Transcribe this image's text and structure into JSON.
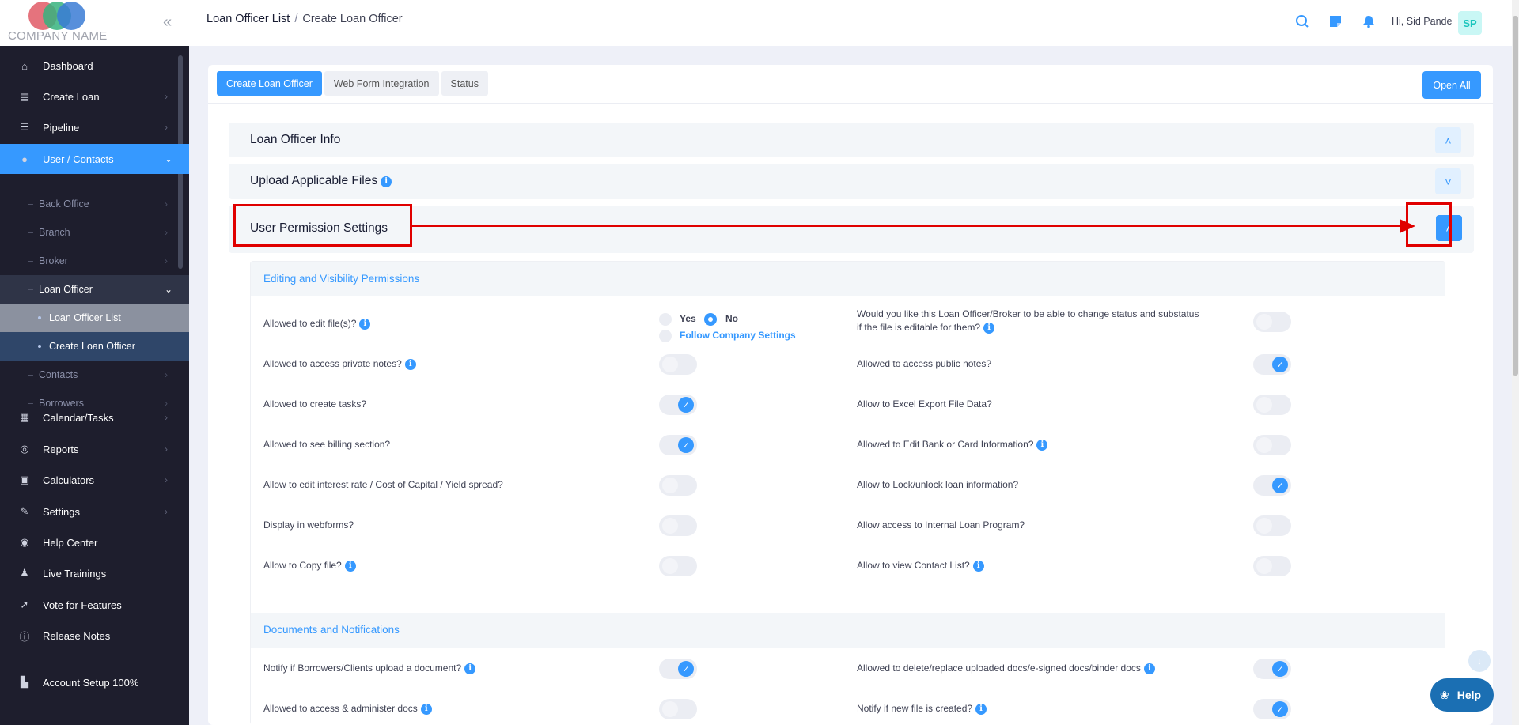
{
  "brand": {
    "company_name": "COMPANY NAME",
    "colors": {
      "red": "#e05b66",
      "green": "#36b37e",
      "blue": "#3a7bd5",
      "accent": "#3699ff"
    }
  },
  "sidebar": {
    "items": [
      {
        "label": "Dashboard",
        "icon": "home-icon"
      },
      {
        "label": "Create Loan",
        "icon": "document-icon"
      },
      {
        "label": "Pipeline",
        "icon": "list-icon"
      },
      {
        "label": "User / Contacts",
        "icon": "user-icon"
      },
      {
        "label": "Calendar/Tasks",
        "icon": "calendar-icon"
      },
      {
        "label": "Reports",
        "icon": "chart-icon"
      },
      {
        "label": "Calculators",
        "icon": "calculator-icon"
      },
      {
        "label": "Settings",
        "icon": "wrench-icon"
      },
      {
        "label": "Help Center",
        "icon": "lifebuoy-icon"
      },
      {
        "label": "Live Trainings",
        "icon": "trainer-icon"
      },
      {
        "label": "Vote for Features",
        "icon": "rocket-icon"
      },
      {
        "label": "Release Notes",
        "icon": "alert-circle-icon"
      },
      {
        "label": "Account Setup 100%",
        "icon": "setup-icon"
      }
    ],
    "user_contacts_children": [
      "Back Office",
      "Branch",
      "Broker",
      "Loan Officer",
      "Contacts",
      "Borrowers"
    ],
    "loan_officer_children": [
      "Loan Officer List",
      "Create Loan Officer"
    ]
  },
  "header": {
    "breadcrumb_parent": "Loan Officer List",
    "breadcrumb_sep": "/",
    "breadcrumb_current": "Create Loan Officer",
    "greeting": "Hi, Sid Pande",
    "avatar_initials": "SP"
  },
  "tabs": [
    "Create Loan Officer",
    "Web Form Integration",
    "Status"
  ],
  "open_all_label": "Open All",
  "sections": {
    "loan_officer_info": "Loan Officer Info",
    "upload_files": "Upload Applicable Files",
    "user_permissions": "User Permission Settings"
  },
  "permissions": {
    "editing_title": "Editing and Visibility Permissions",
    "edit_files_question": "Allowed to edit file(s)?",
    "radio_yes": "Yes",
    "radio_no": "No",
    "radio_follow": "Follow Company Settings",
    "change_status_question_line1": "Would you like this Loan Officer/Broker to be able to change status and substatus",
    "change_status_question_line2": "if the file is editable for them?",
    "rows": [
      {
        "left": "Allowed to access private notes?",
        "left_on": false,
        "left_info": true,
        "right": "Allowed to access public notes?",
        "right_on": true,
        "right_info": false
      },
      {
        "left": "Allowed to create tasks?",
        "left_on": true,
        "left_info": false,
        "right": "Allow to Excel Export File Data?",
        "right_on": false,
        "right_info": false
      },
      {
        "left": "Allowed to see billing section?",
        "left_on": true,
        "left_info": false,
        "right": "Allowed to Edit Bank or Card Information?",
        "right_on": false,
        "right_info": true
      },
      {
        "left": "Allow to edit interest rate / Cost of Capital / Yield spread?",
        "left_on": false,
        "left_info": false,
        "right": "Allow to Lock/unlock loan information?",
        "right_on": true,
        "right_info": false
      },
      {
        "left": "Display in webforms?",
        "left_on": false,
        "left_info": false,
        "right": "Allow access to Internal Loan Program?",
        "right_on": false,
        "right_info": false
      },
      {
        "left": "Allow to Copy file?",
        "left_on": false,
        "left_info": true,
        "right": "Allow to view Contact List?",
        "right_on": false,
        "right_info": true
      }
    ],
    "docs_title": "Documents and Notifications",
    "docs_rows": [
      {
        "left": "Notify if Borrowers/Clients upload a document?",
        "left_on": true,
        "right": "Allowed to delete/replace uploaded docs/e-signed docs/binder docs",
        "right_on": true
      },
      {
        "left": "Allowed to access & administer docs",
        "left_on": false,
        "right": "Notify if new file is created?",
        "right_on": true
      }
    ]
  },
  "help_label": "Help"
}
